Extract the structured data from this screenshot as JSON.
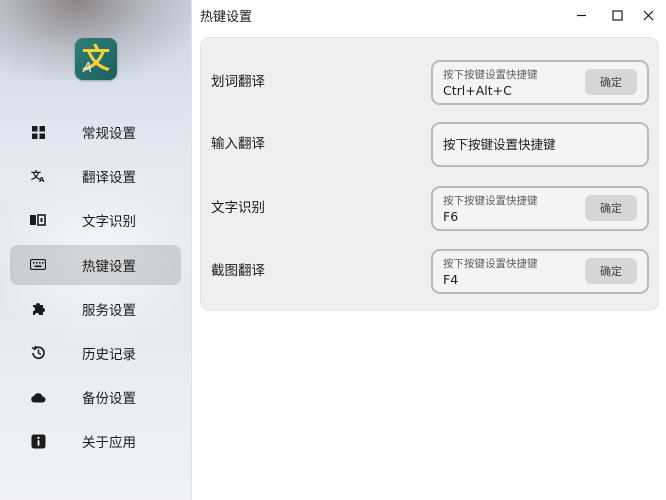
{
  "window": {
    "title": "热键设置"
  },
  "sidebar": {
    "items": [
      {
        "label": "常规设置",
        "icon": "grid-icon"
      },
      {
        "label": "翻译设置",
        "icon": "translate-icon"
      },
      {
        "label": "文字识别",
        "icon": "ocr-icon"
      },
      {
        "label": "热键设置",
        "icon": "keyboard-icon",
        "active": true
      },
      {
        "label": "服务设置",
        "icon": "puzzle-icon"
      },
      {
        "label": "历史记录",
        "icon": "history-icon"
      },
      {
        "label": "备份设置",
        "icon": "cloud-icon"
      },
      {
        "label": "关于应用",
        "icon": "info-icon"
      }
    ]
  },
  "hotkeys": {
    "placeholder": "按下按键设置快捷键",
    "confirm_label": "确定",
    "rows": [
      {
        "label": "划词翻译",
        "value": "Ctrl+Alt+C"
      },
      {
        "label": "输入翻译",
        "value": ""
      },
      {
        "label": "文字识别",
        "value": "F6"
      },
      {
        "label": "截图翻译",
        "value": "F4"
      }
    ]
  },
  "colors": {
    "active_item_bg": "#b5b5b5",
    "card_bg": "#efefef",
    "logo_bg": "#2f7f7a",
    "logo_glyph": "#f3d23a"
  }
}
